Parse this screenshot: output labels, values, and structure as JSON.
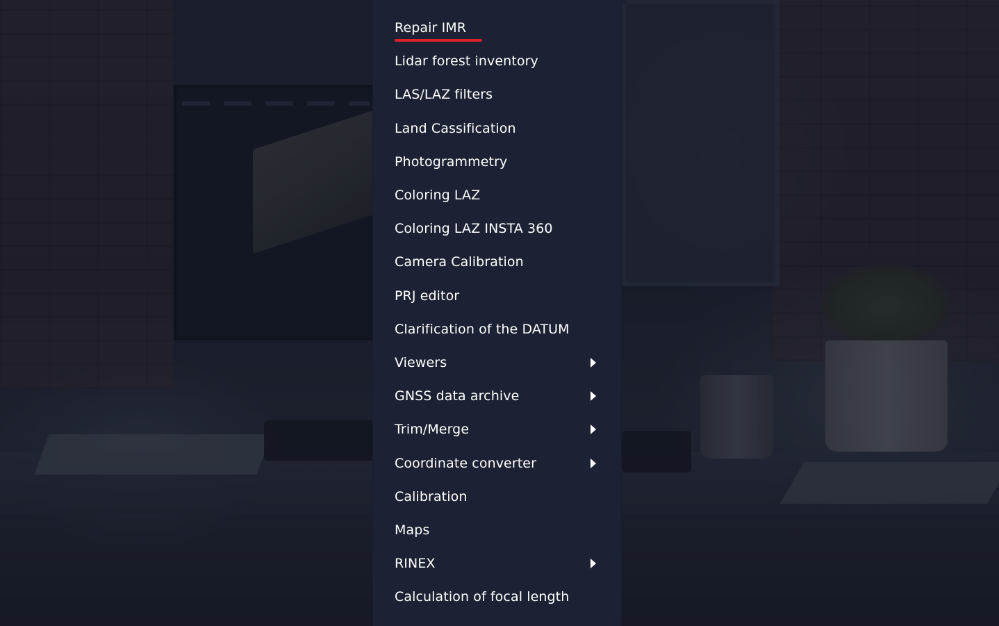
{
  "menu": {
    "items": [
      {
        "label": "Repair IMR",
        "active": true,
        "submenu": false
      },
      {
        "label": "Lidar forest inventory",
        "submenu": false
      },
      {
        "label": "LAS/LAZ filters",
        "submenu": false
      },
      {
        "label": "Land Cassification",
        "submenu": false
      },
      {
        "label": "Photogrammetry",
        "submenu": false
      },
      {
        "label": "Coloring LAZ",
        "submenu": false
      },
      {
        "label": "Coloring LAZ INSTA 360",
        "submenu": false
      },
      {
        "label": "Camera Calibration",
        "submenu": false
      },
      {
        "label": "PRJ editor",
        "submenu": false
      },
      {
        "label": "Clarification of the DATUM",
        "submenu": false
      },
      {
        "label": "Viewers",
        "submenu": true
      },
      {
        "label": "GNSS data archive",
        "submenu": true
      },
      {
        "label": "Trim/Merge",
        "submenu": true
      },
      {
        "label": "Coordinate converter",
        "submenu": true
      },
      {
        "label": "Calibration",
        "submenu": false
      },
      {
        "label": "Maps",
        "submenu": false
      },
      {
        "label": "RINEX",
        "submenu": true
      },
      {
        "label": "Calculation of focal length",
        "submenu": false
      }
    ],
    "colors": {
      "panel_bg": "#1c2233",
      "text": "#ffffff",
      "active_underline": "#e02129"
    },
    "submenu_icon": "chevron-right-icon"
  },
  "background": {
    "scene": "dimmed-office-photo"
  }
}
